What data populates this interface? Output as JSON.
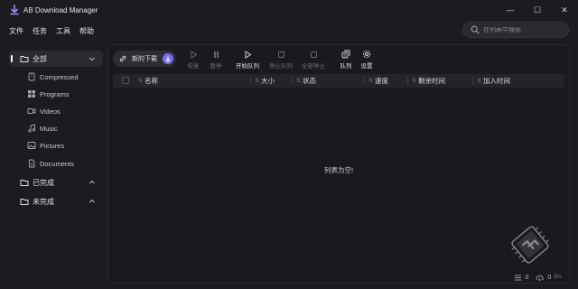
{
  "app": {
    "title": "AB Download Manager"
  },
  "window": {
    "minimize": "—",
    "maximize": "☐",
    "close": "✕"
  },
  "menu": [
    "文件",
    "任务",
    "工具",
    "帮助"
  ],
  "search": {
    "placeholder": "在列表中搜索"
  },
  "sidebar": {
    "all": "全部",
    "categories": [
      "Compressed",
      "Programs",
      "Videos",
      "Music",
      "Pictures",
      "Documents"
    ],
    "finished": "已完成",
    "unfinished": "未完成"
  },
  "toolbar": {
    "new_download": "新的下载",
    "resume": "恢复",
    "pause": "暂停",
    "start_queue": "开始队列",
    "stop_queue": "停止队列",
    "stop_all": "全部停止",
    "queues": "队列",
    "settings": "设置"
  },
  "table": {
    "columns": [
      "名称",
      "大小",
      "状态",
      "速度",
      "剩余时间",
      "加入时间"
    ]
  },
  "empty_message": "列表为空!",
  "status": {
    "active_count": "0",
    "speed": "0",
    "speed_unit": "B/s"
  },
  "colors": {
    "accent": "#7b6cf6",
    "background": "#1c1c20",
    "panel": "#24242a"
  }
}
